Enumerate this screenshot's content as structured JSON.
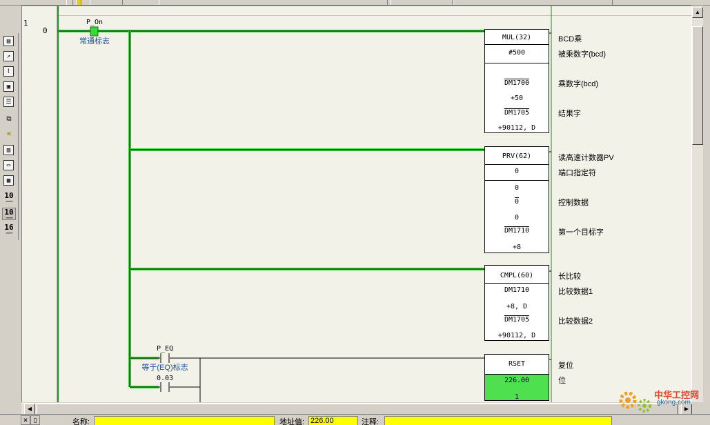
{
  "window": {
    "toolbox_icons": [
      "window-icon",
      "tool-icon",
      "chart-icon",
      "diagram-icon",
      "properties-icon",
      "group-icon",
      "stack-icon",
      "blocks-icon",
      "panel-icon",
      "grid-icon",
      "decimal-format-icon",
      "decimal-format-icon",
      "hex-format-icon"
    ],
    "toolbox_num_labels": [
      "10",
      "10",
      "16"
    ]
  },
  "ladder": {
    "rung_number": "1",
    "step_number": "0",
    "contacts": {
      "p_on": {
        "name": "P_On",
        "comment": "常通标志"
      },
      "p_eq": {
        "name": "P_EQ",
        "comment": "等于(EQ)标志"
      },
      "addr_003": {
        "name": "0.03"
      }
    },
    "blocks": {
      "mul": {
        "title": "MUL(32)",
        "rows": [
          "#500",
          "DM1700",
          "+50",
          "DM1705",
          "+90112, D"
        ],
        "comments": [
          "BCD乘",
          "被乘数字(bcd)",
          "乘数字(bcd)",
          "结果字"
        ]
      },
      "prv": {
        "title": "PRV(62)",
        "rows": [
          "0",
          "0",
          "0",
          "0",
          "DM1710",
          "+8"
        ],
        "comments": [
          "读高速计数器PV",
          "端口指定符",
          "控制数据",
          "第一个目标字"
        ]
      },
      "cmpl": {
        "title": "CMPL(60)",
        "rows": [
          "DM1710",
          "+8, D",
          "DM1705",
          "+90112, D"
        ],
        "comments": [
          "长比较",
          "比较数据1",
          "比较数据2"
        ]
      },
      "rset": {
        "title": "RSET",
        "rows": [
          "226.00",
          "1"
        ],
        "comments": [
          "复位",
          "位"
        ]
      }
    }
  },
  "status": {
    "name_label": "名称:",
    "name_value": "",
    "address_label": "地址值:",
    "address_value": "226.00",
    "comment_label": "注释:",
    "comment_value": ""
  },
  "watermark": {
    "brand": "中华工控网",
    "domain": "gkong.com"
  },
  "colors": {
    "power_flow": "#38d838",
    "editor_bg": "#f3f2e9",
    "status_field": "#ffff00",
    "energized_cell": "#4ee04e",
    "comment_blue": "#1f4e9a"
  }
}
